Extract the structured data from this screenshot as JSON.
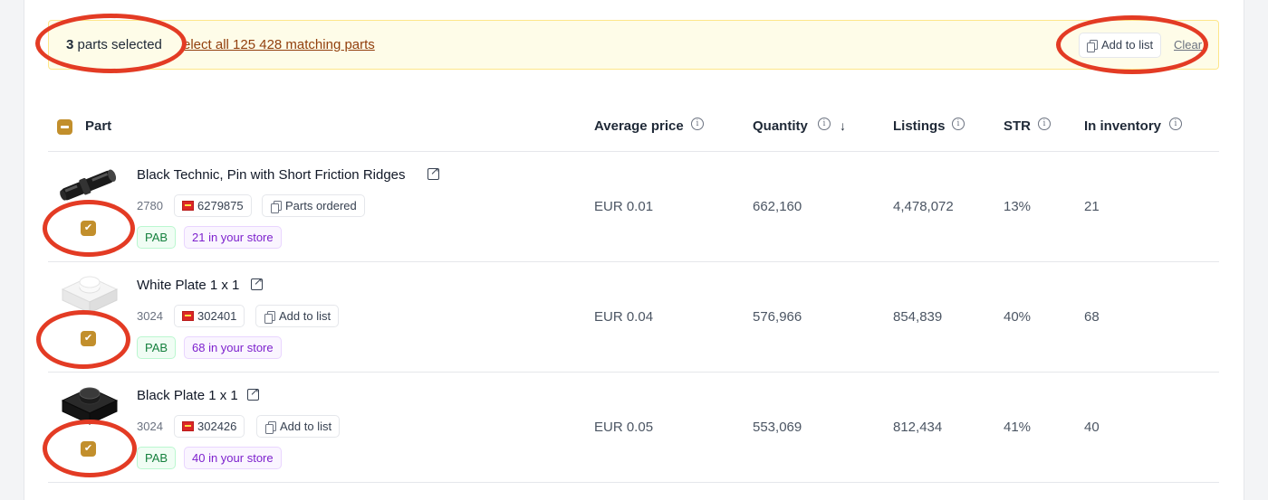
{
  "banner": {
    "count": "3",
    "count_suffix": " parts selected",
    "select_all": "elect all 125 428 matching parts",
    "add_to_list": "Add to list",
    "clear": "Clear"
  },
  "table": {
    "headers": {
      "part": "Part",
      "avg_price": "Average price",
      "quantity": "Quantity",
      "listings": "Listings",
      "str": "STR",
      "inventory": "In inventory"
    },
    "sort_icon": "arrow-down-icon",
    "rows": [
      {
        "name": "Black Technic, Pin with Short Friction Ridges",
        "part_no": "2780",
        "element_id": "6279875",
        "list_action": "Parts ordered",
        "tag": "PAB",
        "store": "21 in your store",
        "avg_price": "EUR 0.01",
        "quantity": "662,160",
        "listings": "4,478,072",
        "str": "13%",
        "inventory": "21",
        "checked": true
      },
      {
        "name": "White Plate 1 x 1",
        "part_no": "3024",
        "element_id": "302401",
        "list_action": "Add to list",
        "tag": "PAB",
        "store": "68 in your store",
        "avg_price": "EUR 0.04",
        "quantity": "576,966",
        "listings": "854,839",
        "str": "40%",
        "inventory": "68",
        "checked": true
      },
      {
        "name": "Black Plate 1 x 1",
        "part_no": "3024",
        "element_id": "302426",
        "list_action": "Add to list",
        "tag": "PAB",
        "store": "40 in your store",
        "avg_price": "EUR 0.05",
        "quantity": "553,069",
        "listings": "812,434",
        "str": "41%",
        "inventory": "40",
        "checked": true
      }
    ]
  },
  "colors": {
    "accent_checkbox": "#c28f2c",
    "annotation_ring": "#e33b24",
    "banner_bg": "#fefce8"
  }
}
